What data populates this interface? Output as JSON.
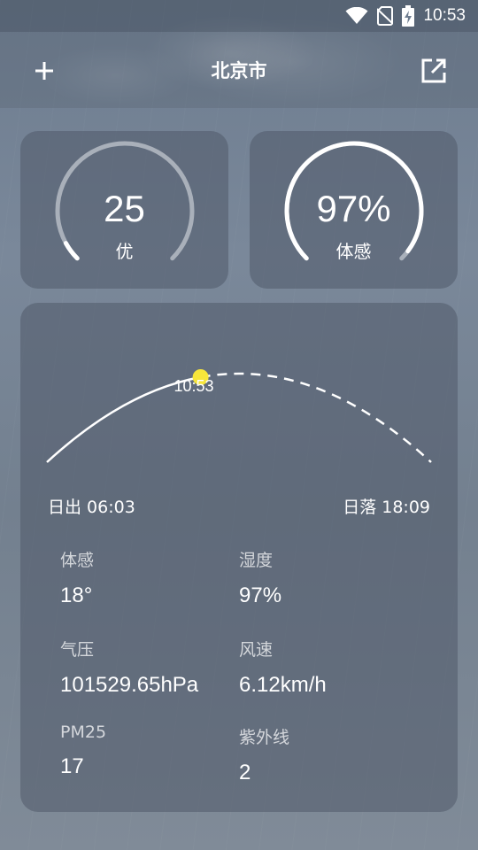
{
  "status_bar": {
    "time": "10:53",
    "icons": [
      "wifi-icon",
      "no-sim-icon",
      "battery-charging-icon"
    ]
  },
  "header": {
    "title": "北京市",
    "add_icon": "plus-icon",
    "share_icon": "open-external-icon"
  },
  "gauges": {
    "aqi": {
      "value": "25",
      "label": "优",
      "fraction": 0.06
    },
    "humidity": {
      "value": "97%",
      "label": "体感",
      "fraction": 0.97
    }
  },
  "sun": {
    "current_time": "10:53",
    "sunrise": "日出 06:03",
    "sunset": "日落 18:09",
    "progress": 0.4
  },
  "details": [
    {
      "label": "体感",
      "value": "18°"
    },
    {
      "label": "湿度",
      "value": "97%"
    },
    {
      "label": "气压",
      "value": "101529.65hPa"
    },
    {
      "label": "风速",
      "value": "6.12km/h"
    },
    {
      "label": "PM25",
      "value": "17"
    },
    {
      "label": "紫外线",
      "value": "2"
    }
  ],
  "colors": {
    "sun_dot": "#f7e63b",
    "track": "#a9b0ba",
    "active": "#ffffff"
  }
}
